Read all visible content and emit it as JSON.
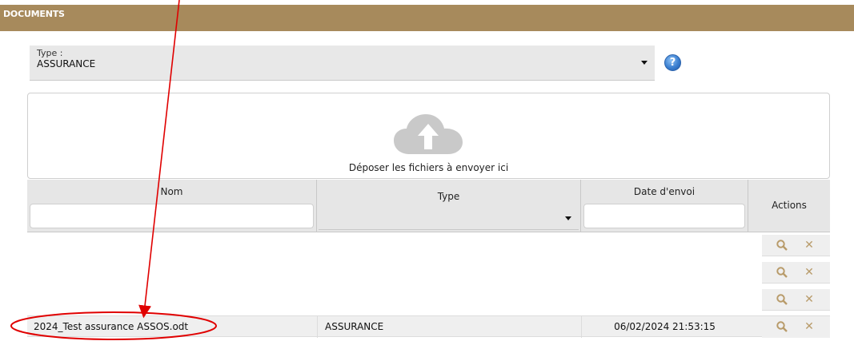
{
  "header": {
    "title": "DOCUMENTS"
  },
  "type_select": {
    "label": "Type :",
    "value": "ASSURANCE"
  },
  "dropzone": {
    "text": "Déposer les fichiers à envoyer ici",
    "icon": "cloud-upload-icon"
  },
  "table": {
    "columns": {
      "name": "Nom",
      "type": "Type",
      "date": "Date d'envoi",
      "actions": "Actions"
    },
    "filters": {
      "name": "",
      "date": ""
    },
    "last_row": {
      "name": "2024_Test assurance ASSOS.odt",
      "type": "ASSURANCE",
      "date": "06/02/2024 21:53:15"
    }
  },
  "colors": {
    "header": "#a78a5c",
    "annotation": "#e00000",
    "action_icon": "#b89b6a"
  }
}
